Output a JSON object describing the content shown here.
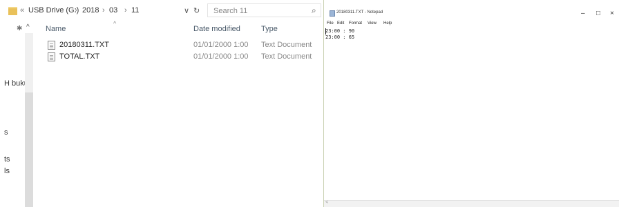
{
  "explorer": {
    "breadcrumb": {
      "overflow": "«",
      "drive": "USB Drive (G:)",
      "sep1": "›",
      "year": "2018",
      "sep2": "›",
      "month": "03",
      "sep3": "›",
      "day": "11"
    },
    "dropdown_glyph": "∨",
    "refresh_glyph": "↻",
    "search_placeholder": "Search 11",
    "search_glyph": "⌕",
    "sort_glyph": "^",
    "pin_glyph": "✱",
    "collapse_glyph": "^",
    "columns": {
      "name": "Name",
      "date": "Date modified",
      "type": "Type"
    },
    "nav_items": [
      "H buku",
      "s",
      "ts",
      "ls"
    ],
    "files": [
      {
        "name": "20180311.TXT",
        "date": "01/01/2000 1:00",
        "type": "Text Document"
      },
      {
        "name": "TOTAL.TXT",
        "date": "01/01/2000 1:00",
        "type": "Text Document"
      }
    ]
  },
  "notepad": {
    "title": "20180311.TXT - Notepad",
    "window_buttons": {
      "minimize": "–",
      "maximize": "□",
      "close": "×"
    },
    "menu": [
      "File",
      "Edit",
      "Format",
      "View",
      "Help"
    ],
    "content": "23:00 : 90\n23:00 : 65",
    "hscroll_glyph": "<"
  }
}
